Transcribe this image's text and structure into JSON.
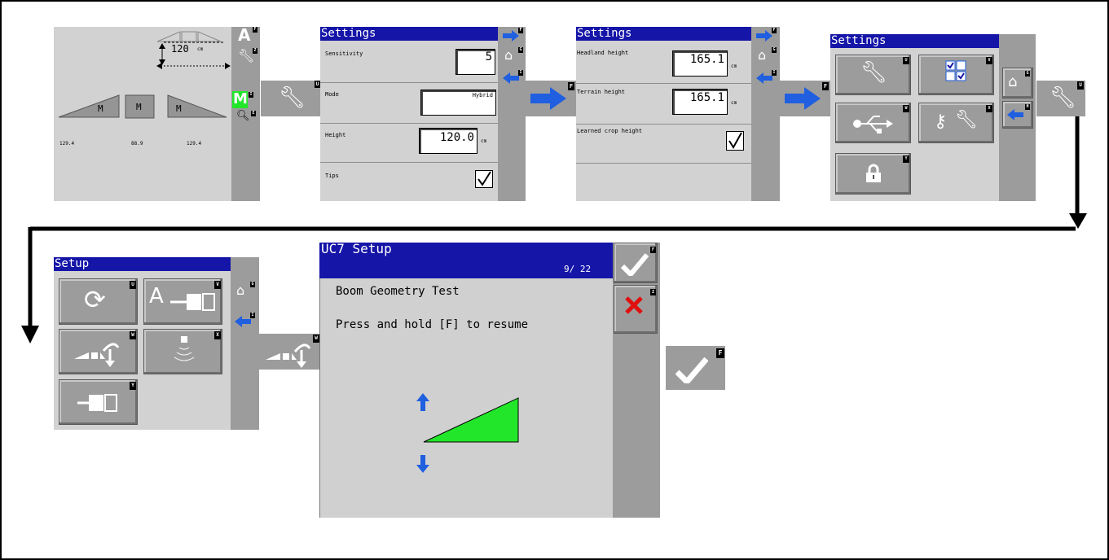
{
  "main_screen": {
    "height_value": "120",
    "height_unit": "cm",
    "mode_label": "M",
    "readings": [
      "129.4",
      "88.9",
      "129.4"
    ],
    "side_keys": {
      "a": "A",
      "a_key": "F",
      "wrench_key": "Z",
      "m": "M",
      "m_key": "I",
      "search_key": "E"
    }
  },
  "wrench_button_1": {
    "key": "U"
  },
  "settings1": {
    "title": "Settings",
    "rows": [
      {
        "label": "Sensitivity",
        "value": "5"
      },
      {
        "label": "Mode",
        "value": "Hybrid"
      },
      {
        "label": "Height",
        "value": "120.0",
        "unit": "cm"
      },
      {
        "label": "Tips"
      }
    ],
    "side_keys": [
      "F",
      "G",
      "I"
    ]
  },
  "next_button_1": {
    "key": "F"
  },
  "settings2": {
    "title": "Settings",
    "rows": [
      {
        "label": "Headland height",
        "value": "165.1",
        "unit": "cm"
      },
      {
        "label": "Terrain height",
        "value": "165.1",
        "unit": "cm"
      },
      {
        "label": "Learned crop height"
      }
    ],
    "side_keys": [
      "F",
      "G",
      "I"
    ]
  },
  "next_button_2": {
    "key": "F"
  },
  "settings3": {
    "title": "Settings",
    "tile_keys": [
      "U",
      "V",
      "W",
      "X",
      "Y"
    ],
    "side_keys": [
      "G",
      "H"
    ]
  },
  "wrench_button_2": {
    "key": "U"
  },
  "setup": {
    "title": "Setup",
    "tile_keys": [
      "U",
      "V",
      "W",
      "X",
      "Y"
    ],
    "tile_v_letter": "A",
    "side_keys": [
      "G",
      "I"
    ]
  },
  "geometry_button": {
    "key": "W"
  },
  "uc7": {
    "title": "UC7 Setup",
    "page": "9/ 22",
    "heading": "Boom Geometry Test",
    "instruction": "Press and hold [F] to resume",
    "side_keys": [
      "F",
      "Z"
    ]
  },
  "confirm_button": {
    "key": "F"
  },
  "colors": {
    "title_blue": "#1515a8",
    "arrow_blue": "#1f5fe0",
    "green": "#22e62a",
    "red": "#e01010"
  }
}
